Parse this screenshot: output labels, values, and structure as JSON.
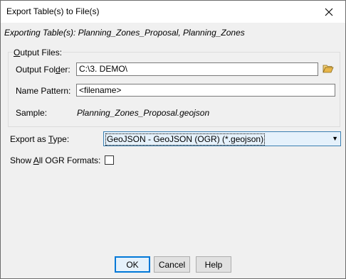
{
  "window": {
    "title": "Export Table(s) to File(s)"
  },
  "subtitle": "Exporting Table(s): Planning_Zones_Proposal, Planning_Zones",
  "output_files": {
    "legend": "Output Files:",
    "output_folder_label": "Output Folder:",
    "output_folder_value": "C:\\3. DEMO\\",
    "name_pattern_label": "Name Pattern:",
    "name_pattern_value": "<filename>",
    "sample_label": "Sample:",
    "sample_value": "Planning_Zones_Proposal.geojson"
  },
  "export_type": {
    "label": "Export as Type:",
    "selected": "GeoJSON - GeoJSON (OGR) (*.geojson)"
  },
  "show_all_formats": {
    "label": "Show All OGR Formats:",
    "checked": false
  },
  "buttons": {
    "ok": "OK",
    "cancel": "Cancel",
    "help": "Help"
  },
  "icons": {
    "close": "close-icon",
    "folder": "folder-open-icon",
    "dropdown": "chevron-down-icon"
  },
  "colors": {
    "accent": "#0078d7",
    "folder": "#e8b64a"
  }
}
